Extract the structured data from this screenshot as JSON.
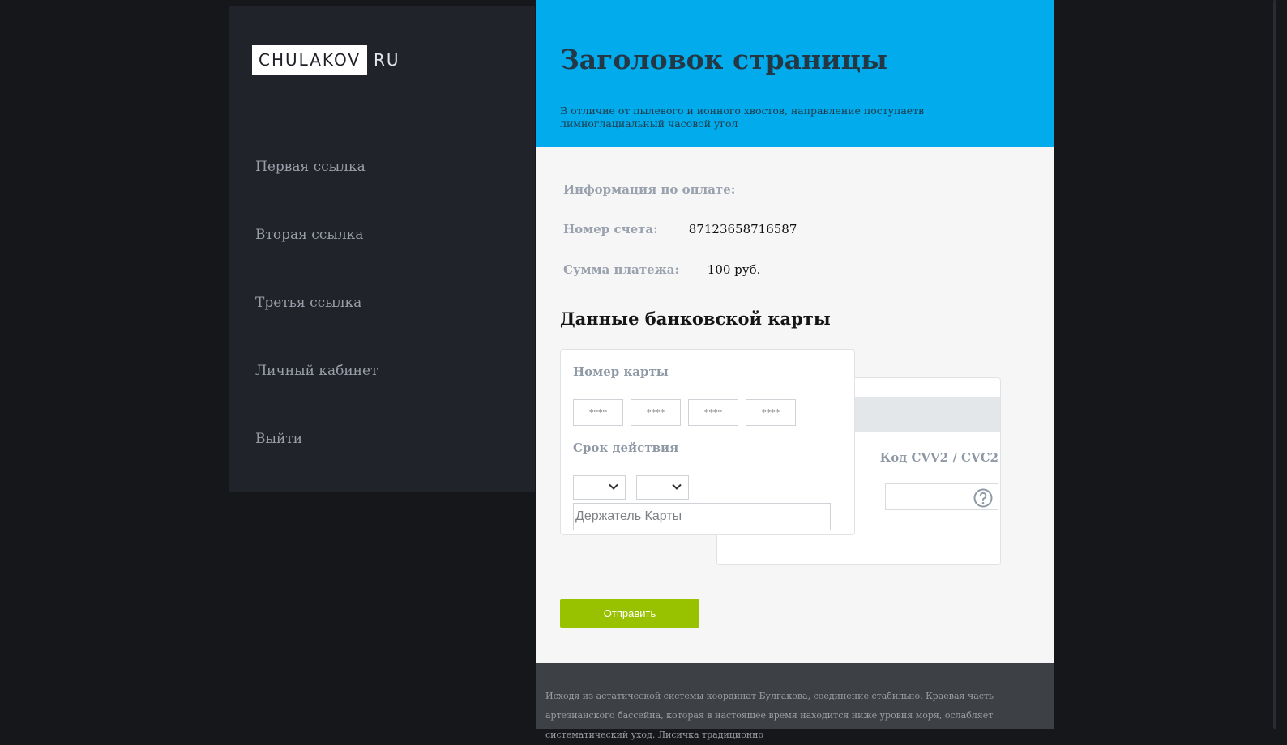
{
  "logo": {
    "brand": "CHULAKOV",
    "suffix": "RU"
  },
  "nav": {
    "items": [
      {
        "label": "Первая ссылка"
      },
      {
        "label": "Вторая ссылка"
      },
      {
        "label": "Третья ссылка"
      },
      {
        "label": "Личный кабинет"
      },
      {
        "label": "Выйти"
      }
    ]
  },
  "header": {
    "title": "Заголовок страницы",
    "subtitle": "В отличие от пылевого и ионного хвостов, направление поступаетв лимноглациальный часовой угол"
  },
  "payment": {
    "section_label": "Информация по оплате:",
    "account_label": "Номер счета:",
    "account_value": "87123658716587",
    "amount_label": "Сумма платежа:",
    "amount_value": "100 руб."
  },
  "card": {
    "section_title": "Данные банковской карты",
    "number_label": "Номер карты",
    "number_placeholder": "****",
    "expiry_label": "Срок действия",
    "holder_placeholder": "Держатель Карты",
    "cvv_label": "Код CVV2 / CVC2"
  },
  "submit_label": "Отправить",
  "footer_text": "Исходя из астатической системы координат Булгакова, соединение стабильно. Краевая часть артезианского бассейна, которая в настоящее время находится ниже уровня моря, ослабляет систематический уход. Лисичка традиционно",
  "colors": {
    "accent": "#02abeb",
    "button": "#98c100",
    "sidebar": "#21232b",
    "footer": "#3d4044"
  }
}
